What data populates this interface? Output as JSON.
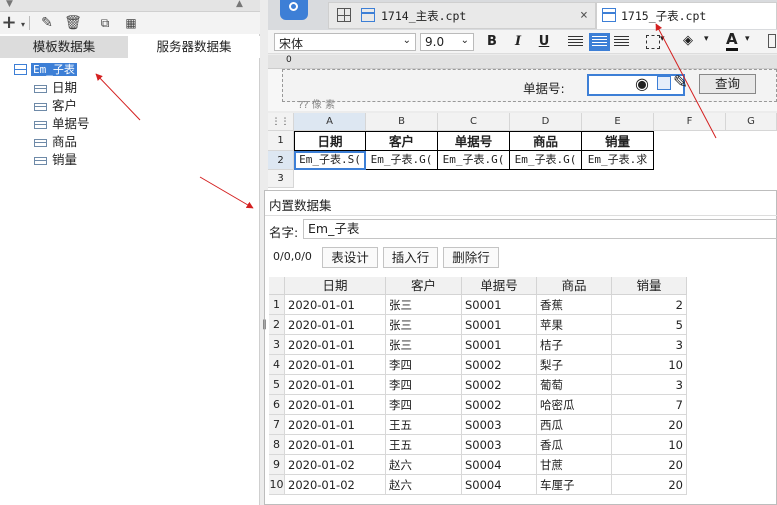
{
  "left_panel": {
    "tabs": [
      "模板数据集",
      "服务器数据集"
    ],
    "dataset_name": "Em_子表",
    "fields": [
      "日期",
      "客户",
      "单据号",
      "商品",
      "销量"
    ]
  },
  "doc_tabs": [
    {
      "label": "1714_主表.cpt",
      "closable": true
    },
    {
      "label": "1715_子表.cpt",
      "closable": false
    }
  ],
  "format_bar": {
    "font_family": "宋体",
    "font_size": "9.0",
    "bold": "B",
    "italic": "I",
    "underline": "U",
    "font_color_letter": "A"
  },
  "param_bar": {
    "ruler_mark": "0",
    "label": "单据号:",
    "query_button": "查询",
    "hint": "?? 像 素"
  },
  "grid": {
    "columns": [
      "A",
      "B",
      "C",
      "D",
      "E",
      "F",
      "G"
    ],
    "rows": [
      "1",
      "2",
      "3"
    ],
    "headers": [
      "日期",
      "客户",
      "单据号",
      "商品",
      "销量"
    ],
    "bindings": [
      "Em_子表.S(",
      "Em_子表.G(",
      "Em_子表.G(",
      "Em_子表.G(",
      "Em_子表.求"
    ]
  },
  "dialog": {
    "title": "内置数据集",
    "name_label": "名字:",
    "name_value": "Em_子表",
    "position": "0/0,0/0",
    "buttons": [
      "表设计",
      "插入行",
      "删除行"
    ],
    "columns": [
      "日期",
      "客户",
      "单据号",
      "商品",
      "销量"
    ],
    "rows": [
      {
        "no": "1",
        "date": "2020-01-01",
        "customer": "张三",
        "doc": "S0001",
        "product": "香蕉",
        "qty": "2"
      },
      {
        "no": "2",
        "date": "2020-01-01",
        "customer": "张三",
        "doc": "S0001",
        "product": "苹果",
        "qty": "5"
      },
      {
        "no": "3",
        "date": "2020-01-01",
        "customer": "张三",
        "doc": "S0001",
        "product": "桔子",
        "qty": "3"
      },
      {
        "no": "4",
        "date": "2020-01-01",
        "customer": "李四",
        "doc": "S0002",
        "product": "梨子",
        "qty": "10"
      },
      {
        "no": "5",
        "date": "2020-01-01",
        "customer": "李四",
        "doc": "S0002",
        "product": "葡萄",
        "qty": "3"
      },
      {
        "no": "6",
        "date": "2020-01-01",
        "customer": "李四",
        "doc": "S0002",
        "product": "哈密瓜",
        "qty": "7"
      },
      {
        "no": "7",
        "date": "2020-01-01",
        "customer": "王五",
        "doc": "S0003",
        "product": "西瓜",
        "qty": "20"
      },
      {
        "no": "8",
        "date": "2020-01-01",
        "customer": "王五",
        "doc": "S0003",
        "product": "香瓜",
        "qty": "10"
      },
      {
        "no": "9",
        "date": "2020-01-02",
        "customer": "赵六",
        "doc": "S0004",
        "product": "甘蔗",
        "qty": "20"
      },
      {
        "no": "10",
        "date": "2020-01-02",
        "customer": "赵六",
        "doc": "S0004",
        "product": "车厘子",
        "qty": "20"
      }
    ]
  },
  "colors": {
    "accent": "#3d7fd6",
    "selected_tab": "#d8d8d8",
    "arrow": "#d42020"
  }
}
